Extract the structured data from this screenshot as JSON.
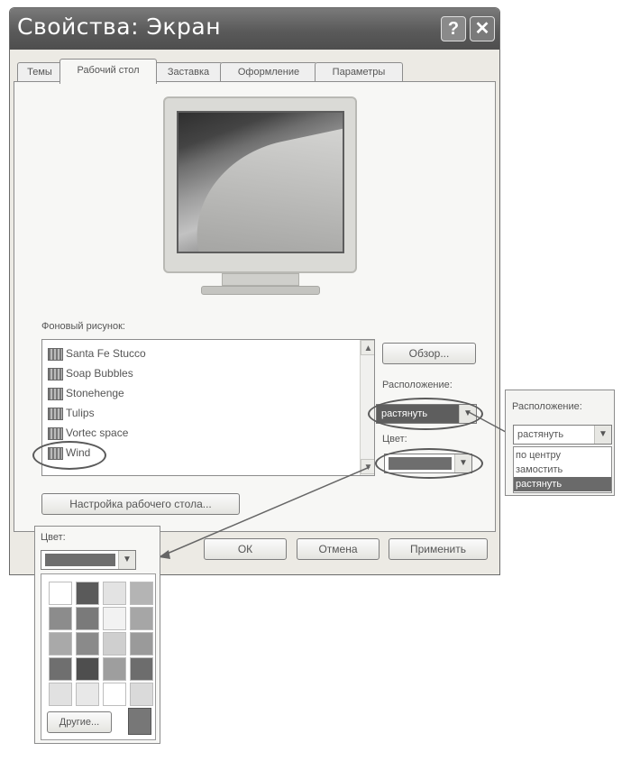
{
  "dialog": {
    "title": "Свойства: Экран",
    "help_glyph": "?",
    "close_glyph": "✕",
    "tabs": [
      "Темы",
      "Рабочий стол",
      "Заставка",
      "Оформление",
      "Параметры"
    ],
    "active_tab": "Рабочий стол",
    "background_label": "Фоновый рисунок:",
    "backgrounds": [
      "Santa Fe Stucco",
      "Soap Bubbles",
      "Stonehenge",
      "Tulips",
      "Vortec space",
      "Wind"
    ],
    "selected_background": "Wind",
    "browse_button": "Обзор...",
    "position_label": "Расположение:",
    "position_value": "растянуть",
    "color_label": "Цвет:",
    "customize_button": "Настройка рабочего стола...",
    "ok_button": "ОК",
    "cancel_button": "Отмена",
    "apply_button": "Применить"
  },
  "position_popup": {
    "label": "Расположение:",
    "value": "растянуть",
    "options": [
      "по центру",
      "замостить",
      "растянуть"
    ],
    "highlighted": "растянуть"
  },
  "color_popup": {
    "label": "Цвет:",
    "other_button": "Другие...",
    "swatches": [
      "#ffffff",
      "#5a5a5a",
      "#e3e3e3",
      "#b4b4b4",
      "#8c8c8c",
      "#7a7a7a",
      "#f2f2f2",
      "#a6a6a6",
      "#a9a9a9",
      "#8a8a8a",
      "#cfcfcf",
      "#9a9a9a",
      "#6f6f6f",
      "#4e4e4e",
      "#9e9e9e",
      "#6d6d6d",
      "#e1e1e1",
      "#e8e8e8",
      "#ffffff",
      "#dadada"
    ]
  }
}
